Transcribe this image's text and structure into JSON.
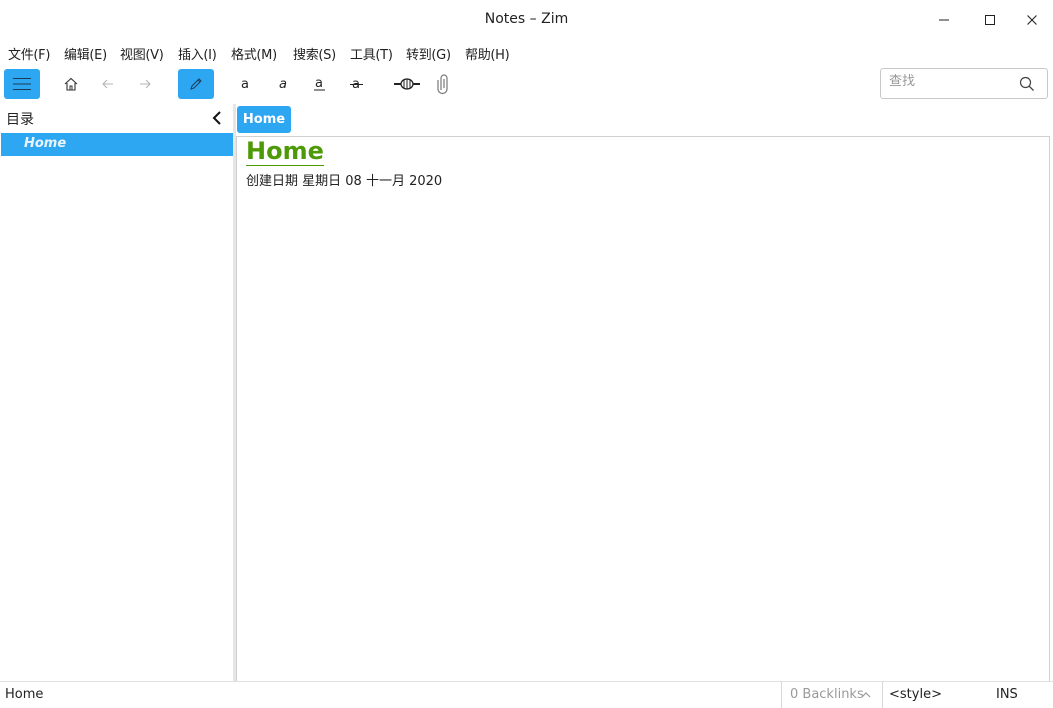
{
  "window": {
    "title": "Notes – Zim"
  },
  "menu": [
    {
      "label": "文件(F)"
    },
    {
      "label": "编辑(E)"
    },
    {
      "label": "视图(V)"
    },
    {
      "label": "插入(I)"
    },
    {
      "label": "格式(M)"
    },
    {
      "label": "搜索(S)"
    },
    {
      "label": "工具(T)"
    },
    {
      "label": "转到(G)"
    },
    {
      "label": "帮助(H)"
    }
  ],
  "toolbar": {
    "menu_icon": "hamburger-icon",
    "home_icon": "home-icon",
    "back_icon": "arrow-left-icon",
    "forward_icon": "arrow-right-icon",
    "edit_icon": "pencil-icon",
    "bold_glyph": "a",
    "italic_glyph": "a",
    "underline_glyph": "a",
    "strike_glyph": "a",
    "link_icon": "link-icon",
    "attach_icon": "paperclip-icon",
    "accent_color": "#2ea7f2"
  },
  "search": {
    "placeholder": "查找",
    "value": ""
  },
  "sidebar": {
    "title": "目录",
    "items": [
      {
        "label": "Home",
        "selected": true
      }
    ]
  },
  "pathbar": {
    "items": [
      {
        "label": "Home"
      }
    ]
  },
  "page": {
    "heading": "Home",
    "created": "创建日期 星期日 08 十一月 2020",
    "heading_color": "#4e9a06"
  },
  "status": {
    "page": "Home",
    "backlinks": "0 Backlinks",
    "style": "<style>",
    "mode": "INS"
  }
}
